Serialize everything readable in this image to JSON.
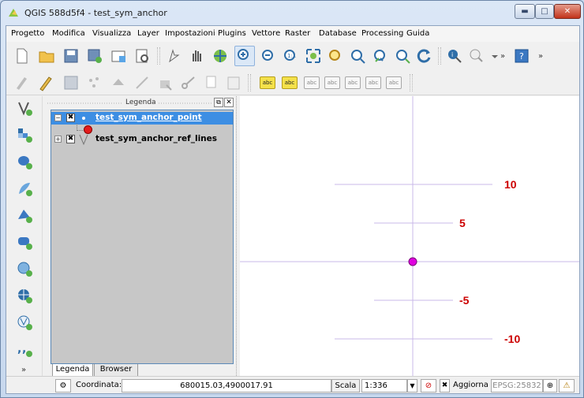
{
  "window": {
    "title": "QGIS 588d5f4 - test_sym_anchor",
    "min_label": "▬",
    "max_label": "□",
    "close_label": "✕"
  },
  "menu": [
    {
      "label": "Progetto"
    },
    {
      "label": "Modifica"
    },
    {
      "label": "Visualizza"
    },
    {
      "label": "Layer"
    },
    {
      "label": "Impostazioni"
    },
    {
      "label": "Plugins"
    },
    {
      "label": "Vettore"
    },
    {
      "label": "Raster"
    },
    {
      "label": "Database"
    },
    {
      "label": "Processing"
    },
    {
      "label": "Guida"
    }
  ],
  "toolbar2": {
    "label_tools": [
      "abc",
      "abc",
      "abc",
      "abc",
      "abc",
      "abc",
      "abc"
    ]
  },
  "legend": {
    "title": "Legenda",
    "float_btn": "⧉",
    "close_btn": "✕",
    "layers": [
      {
        "name": "test_sym_anchor_point",
        "checked": "✖",
        "expand": "−",
        "selected": true
      },
      {
        "name": "test_sym_anchor_ref_lines",
        "checked": "✖",
        "expand": "+",
        "selected": false
      }
    ],
    "tabs": [
      "Legenda",
      "Browser"
    ]
  },
  "map": {
    "labels": [
      "10",
      "5",
      "-5",
      "-10"
    ],
    "label_color": "#cc0000",
    "line_color": "#c9b8e8",
    "point_color": "#e000e0"
  },
  "status": {
    "coord_label": "Coordinata:",
    "coord_value": "680015.03,4900017.91",
    "scale_label": "Scala",
    "scale_value": "1:336",
    "refresh_label": "Aggiorna",
    "refresh_check": "✖",
    "crs": "EPSG:25832"
  }
}
